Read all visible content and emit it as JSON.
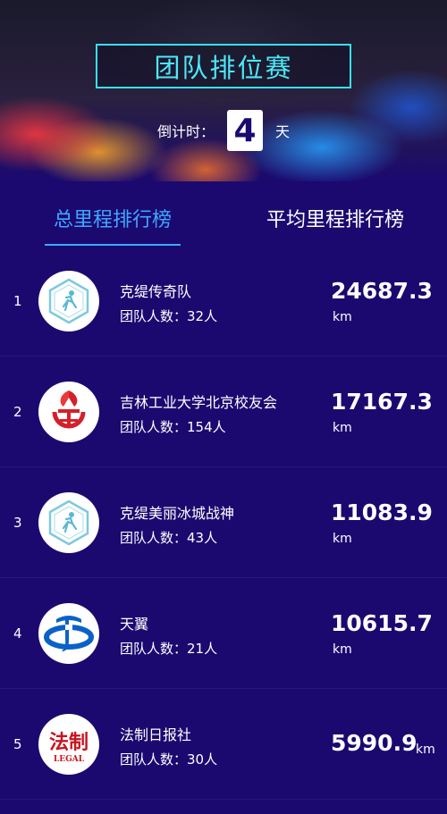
{
  "header": {
    "title": "团队排位赛",
    "countdown_label": "倒计时：",
    "countdown_value": "4",
    "countdown_unit": "天"
  },
  "tabs": [
    {
      "label": "总里程排行榜",
      "active": true
    },
    {
      "label": "平均里程排行榜",
      "active": false
    }
  ],
  "teams": [
    {
      "rank": "1",
      "name": "克缇传奇队",
      "members": "团队人数：32人",
      "distance": "24687.3",
      "unit": "km",
      "logo": "runner-hexagon-icon"
    },
    {
      "rank": "2",
      "name": "吉林工业大学北京校友会",
      "members": "团队人数：154人",
      "distance": "17167.3",
      "unit": "km",
      "logo": "university-emblem-icon"
    },
    {
      "rank": "3",
      "name": "克缇美丽冰城战神",
      "members": "团队人数：43人",
      "distance": "11083.9",
      "unit": "km",
      "logo": "runner-hexagon-icon"
    },
    {
      "rank": "4",
      "name": "天翼",
      "members": "团队人数：21人",
      "distance": "10615.7",
      "unit": "km",
      "logo": "china-telecom-icon"
    },
    {
      "rank": "5",
      "name": "法制日报社",
      "members": "团队人数：30人",
      "distance": "5990.9",
      "unit": "km",
      "logo": "legal-daily-icon",
      "logo_text": "法制",
      "logo_subtext": "LEGAL"
    }
  ],
  "colors": {
    "background": "#1b0970",
    "accent": "#3ea8ff",
    "title": "#4ee8f8"
  }
}
